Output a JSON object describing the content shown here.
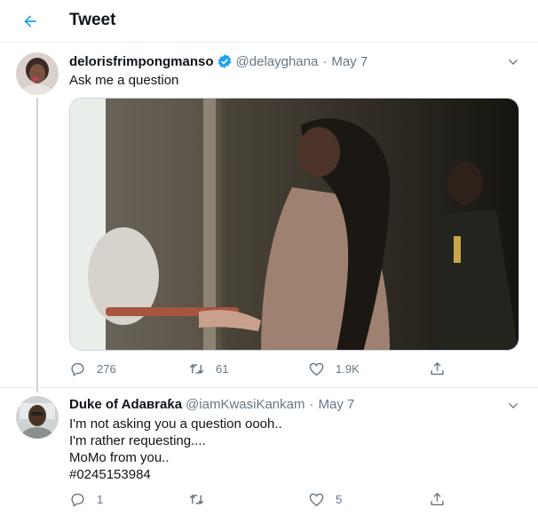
{
  "header": {
    "title": "Tweet",
    "back_icon": "back-arrow-icon"
  },
  "colors": {
    "accent": "#1da1f2",
    "text": "#0f1419",
    "muted": "#657786",
    "border": "#e6ecf0"
  },
  "main_tweet": {
    "display_name": "delorisfrimpongmanso",
    "verified": true,
    "handle": "@delayghana",
    "separator": "·",
    "date": "May 7",
    "text": "Ask me a question",
    "actions": {
      "replies": "276",
      "retweets": "61",
      "likes": "1.9K"
    }
  },
  "reply": {
    "display_name": "Duke of Adaвraƙa",
    "handle": "@iamKwasiKankam",
    "separator": "·",
    "date": "May 7",
    "lines": [
      "I'm not asking you a question oooh..",
      "I'm rather requesting....",
      "MoMo from you..",
      "#0245153984"
    ],
    "actions": {
      "replies": "1",
      "retweets": "",
      "likes": "5"
    }
  }
}
